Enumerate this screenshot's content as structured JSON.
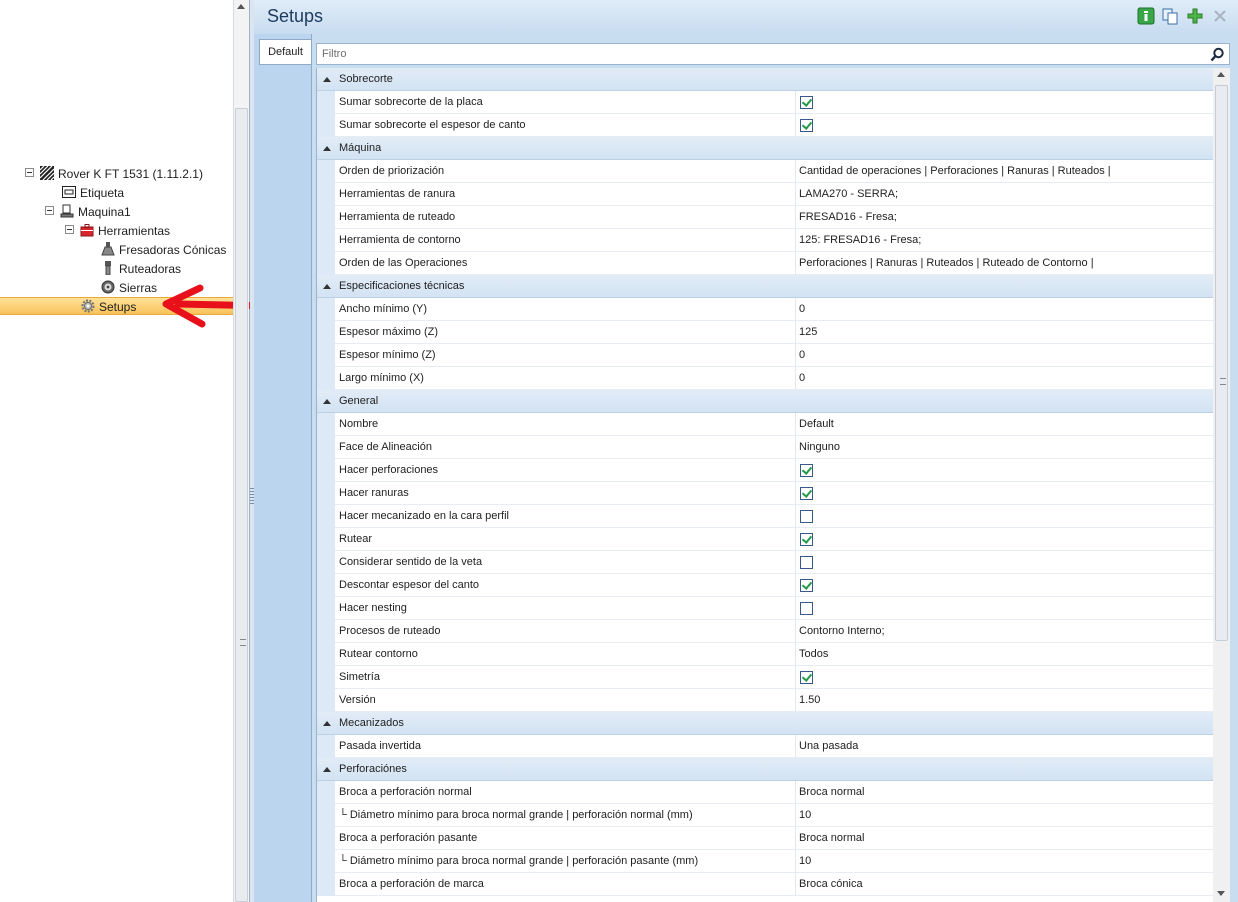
{
  "tree": {
    "root": "Rover K FT 1531 (1.11.2.1)",
    "etiqueta": "Etiqueta",
    "maquina": "Maquina1",
    "herramientas": "Herramientas",
    "fresadoras": "Fresadoras Cónicas",
    "ruteadoras": "Ruteadoras",
    "sierras": "Sierras",
    "setups": "Setups"
  },
  "header": {
    "title": "Setups",
    "icons": [
      "info-icon",
      "copy-icon",
      "add-icon",
      "close-icon"
    ]
  },
  "tabs": {
    "default": "Default"
  },
  "filter": {
    "placeholder": "Filtro"
  },
  "colors": {
    "selection": "#f8c25a",
    "accent_green": "#1f9a45",
    "header_bg": "#c8dcf0",
    "arrow_red": "#e8101a"
  },
  "grid": {
    "sobrecorte": {
      "label": "Sobrecorte",
      "p1": {
        "name": "Sumar sobrecorte de la placa",
        "checked": true
      },
      "p2": {
        "name": "Sumar sobrecorte el espesor de canto",
        "checked": true
      }
    },
    "maquina": {
      "label": "Máquina",
      "p1": {
        "name": "Orden de priorización",
        "value": "Cantidad de operaciones | Perforaciones | Ranuras | Ruteados |"
      },
      "p2": {
        "name": "Herramientas de ranura",
        "value": "LAMA270 - SERRA;"
      },
      "p3": {
        "name": "Herramienta de ruteado",
        "value": "FRESAD16 - Fresa;"
      },
      "p4": {
        "name": "Herramienta de contorno",
        "value": "125: FRESAD16 - Fresa;"
      },
      "p5": {
        "name": "Orden de las Operaciones",
        "value": "Perforaciones | Ranuras | Ruteados | Ruteado de Contorno |"
      }
    },
    "especificaciones": {
      "label": "Especificaciones técnicas",
      "p1": {
        "name": "Ancho mínimo (Y)",
        "value": "0"
      },
      "p2": {
        "name": "Espesor máximo (Z)",
        "value": "125"
      },
      "p3": {
        "name": "Espesor mínimo (Z)",
        "value": "0"
      },
      "p4": {
        "name": "Largo mínimo (X)",
        "value": "0"
      }
    },
    "general": {
      "label": "General",
      "p1": {
        "name": "Nombre",
        "value": "Default"
      },
      "p2": {
        "name": "Face de Alineación",
        "value": "Ninguno"
      },
      "p3": {
        "name": "Hacer perforaciones",
        "checked": true
      },
      "p4": {
        "name": "Hacer ranuras",
        "checked": true
      },
      "p5": {
        "name": "Hacer mecanizado en la cara perfil",
        "checked": false
      },
      "p6": {
        "name": "Rutear",
        "checked": true
      },
      "p7": {
        "name": "Considerar sentido de la veta",
        "checked": false
      },
      "p8": {
        "name": "Descontar espesor del canto",
        "checked": true
      },
      "p9": {
        "name": "Hacer nesting",
        "checked": false
      },
      "p10": {
        "name": "Procesos de ruteado",
        "value": "Contorno Interno;"
      },
      "p11": {
        "name": "Rutear contorno",
        "value": "Todos"
      },
      "p12": {
        "name": "Simetría",
        "checked": true
      },
      "p13": {
        "name": "Versión",
        "value": "1.50"
      }
    },
    "mecanizados": {
      "label": "Mecanizados",
      "p1": {
        "name": "Pasada invertida",
        "value": "Una pasada"
      }
    },
    "perforaciones": {
      "label": "Perforaciónes",
      "p1": {
        "name": "Broca a perforación normal",
        "value": "Broca normal"
      },
      "p2": {
        "name": "└ Diámetro mínimo para broca normal grande | perforación normal (mm)",
        "value": "10"
      },
      "p3": {
        "name": "Broca a perforación pasante",
        "value": "Broca normal"
      },
      "p4": {
        "name": "└ Diámetro mínimo para broca normal grande | perforación pasante (mm)",
        "value": "10"
      },
      "p5": {
        "name": "Broca a perforación de marca",
        "value": "Broca cónica"
      }
    }
  }
}
